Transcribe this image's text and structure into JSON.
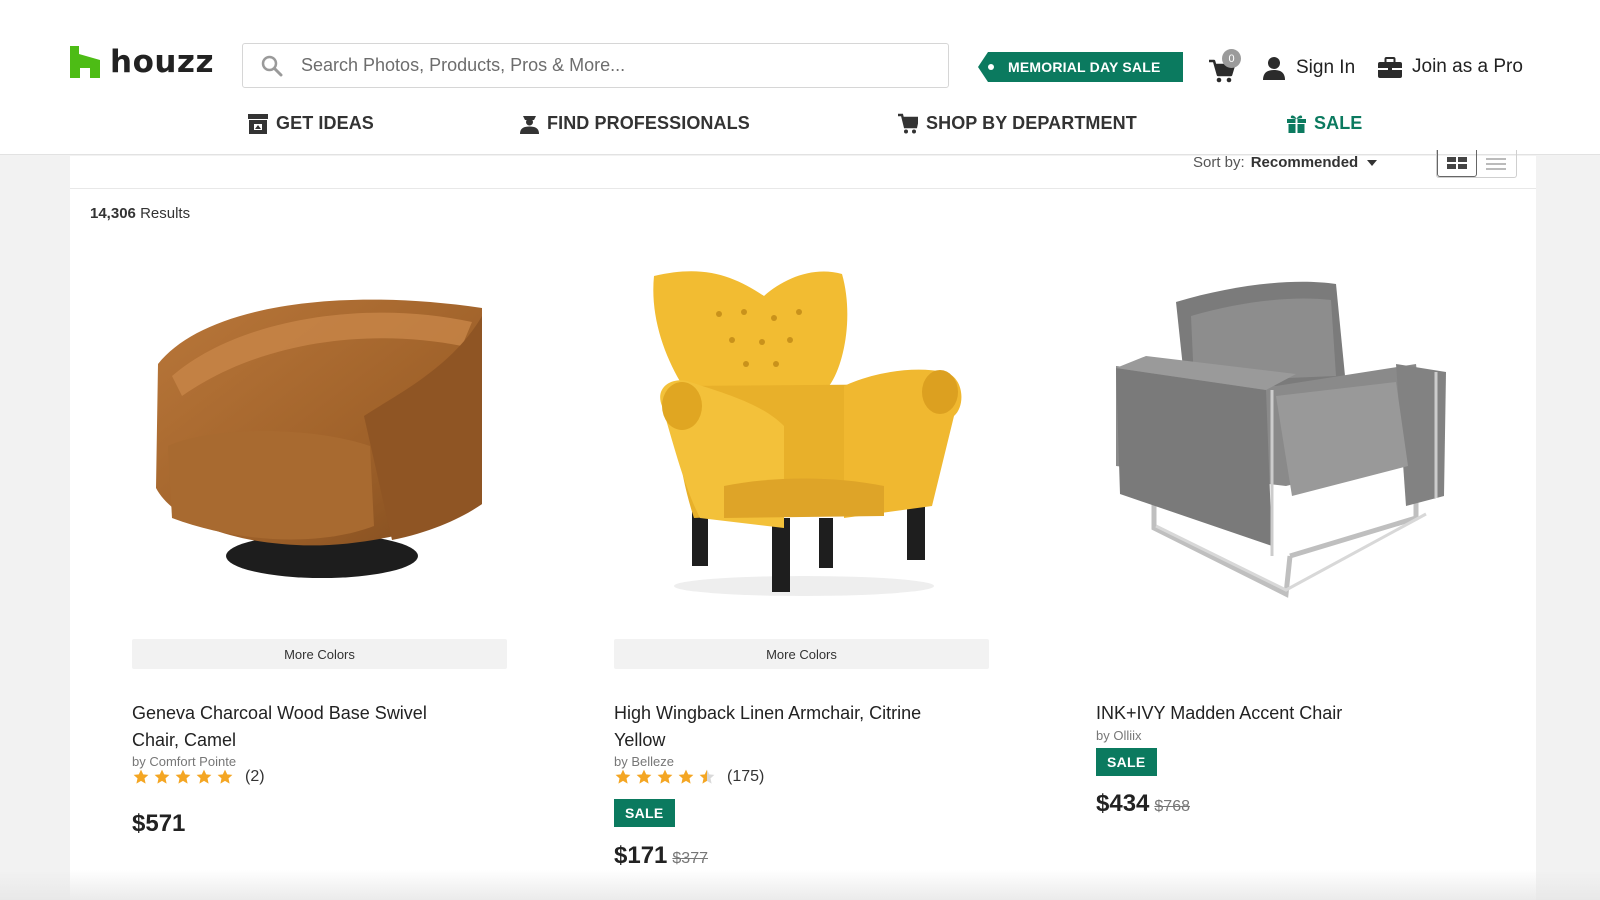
{
  "brand": {
    "name": "houzz",
    "color": "#4dbc15"
  },
  "search": {
    "placeholder": "Search Photos, Products, Pros & More..."
  },
  "header": {
    "promo_label": "MEMORIAL DAY SALE",
    "cart_count": "0",
    "sign_in": "Sign In",
    "join_pro": "Join as a Pro"
  },
  "nav": {
    "items": [
      {
        "label": "GET IDEAS",
        "icon": "ideas-icon"
      },
      {
        "label": "FIND PROFESSIONALS",
        "icon": "professional-icon"
      },
      {
        "label": "SHOP BY DEPARTMENT",
        "icon": "shop-icon"
      },
      {
        "label": "SALE",
        "icon": "gift-icon"
      }
    ]
  },
  "listing": {
    "sort_label": "Sort by:",
    "sort_value": "Recommended",
    "results_count": "14,306",
    "results_label": "Results"
  },
  "products": [
    {
      "title": "Geneva Charcoal Wood Base Swivel Chair, Camel",
      "by": "by Comfort Pointe",
      "more_colors": "More Colors",
      "rating": 5,
      "reviews": "(2)",
      "sale": "",
      "price": "$571",
      "was": ""
    },
    {
      "title": "High Wingback Linen Armchair, Citrine Yellow",
      "by": "by Belleze",
      "more_colors": "More Colors",
      "rating": 4.5,
      "reviews": "(175)",
      "sale": "SALE",
      "price": "$171",
      "was": "$377"
    },
    {
      "title": "INK+IVY Madden Accent Chair",
      "by": "by Olliix",
      "more_colors": "",
      "rating": 0,
      "reviews": "",
      "sale": "SALE",
      "price": "$434",
      "was": "$768"
    }
  ],
  "colors": {
    "accent": "#0b7a5f",
    "star": "#f4a623"
  }
}
